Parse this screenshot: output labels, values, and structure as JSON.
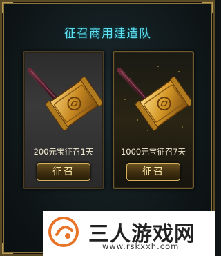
{
  "dialog": {
    "title": "征召商用建造队"
  },
  "cards": [
    {
      "label": "200元宝征召1天",
      "button_label": "征召",
      "icon": "golden-hammer-icon"
    },
    {
      "label": "1000元宝征召7天",
      "button_label": "征召",
      "icon": "golden-hammer-icon"
    }
  ],
  "watermark": {
    "brand": "三人游戏网",
    "url": "www.rskxxh.com"
  },
  "colors": {
    "title": "#5fe0f0",
    "gold": "#d6b35a",
    "button_text": "#ffe9a8"
  }
}
